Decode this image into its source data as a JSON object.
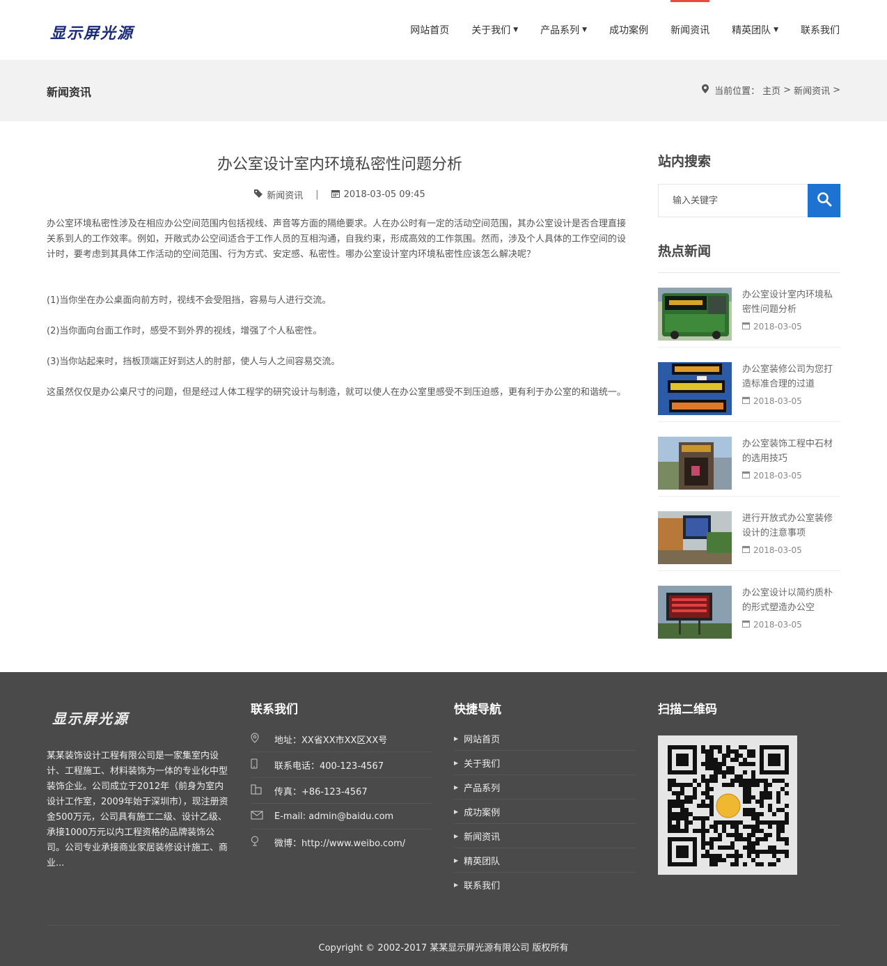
{
  "header": {
    "logo": "显示屏光源",
    "nav": [
      {
        "label": "网站首页",
        "caret": false,
        "active": false
      },
      {
        "label": "关于我们",
        "caret": true,
        "active": false
      },
      {
        "label": "产品系列",
        "caret": true,
        "active": false
      },
      {
        "label": "成功案例",
        "caret": false,
        "active": false
      },
      {
        "label": "新闻资讯",
        "caret": false,
        "active": true
      },
      {
        "label": "精英团队",
        "caret": true,
        "active": false
      },
      {
        "label": "联系我们",
        "caret": false,
        "active": false
      }
    ]
  },
  "banner": {
    "title": "新闻资讯",
    "crumb_prefix": "当前位置：",
    "crumb_home": "主页",
    "crumb_sep": ">",
    "crumb_current": "新闻资讯"
  },
  "article": {
    "title": "办公室设计室内环境私密性问题分析",
    "category": "新闻资讯",
    "divider": "|",
    "datetime": "2018-03-05 09:45",
    "paragraphs": [
      "办公室环境私密性涉及在相应办公空间范围内包括视线、声音等方面的隔绝要求。人在办公时有一定的活动空间范围，其办公室设计是否合理直接关系到人的工作效率。例如，开敞式办公空间适合于工作人员的互相沟通，自我约束，形成高效的工作氛围。然而，涉及个人具体的工作空间的设计时，要考虑到其具体工作活动的空间范围、行为方式、安定感、私密性。哪办公室设计室内环境私密性应该怎么解决呢？",
      "(1)当你坐在办公桌面向前方时，视线不会受阻挡，容易与人进行交流。",
      "(2)当你面向台面工作时，感受不到外界的视线，增强了个人私密性。",
      "(3)当你站起来时，挡板顶端正好到达人的肘部，使人与人之间容易交流。",
      "这虽然仅仅是办公桌尺寸的问题，但是经过人体工程学的研究设计与制造，就可以使人在办公室里感受不到压迫感，更有利于办公室的和谐统一。"
    ]
  },
  "sidebar": {
    "search_heading": "站内搜索",
    "search_placeholder": "输入关键字",
    "hot_heading": "热点新闻",
    "news": [
      {
        "title": "办公室设计室内环境私密性问题分析",
        "date": "2018-03-05"
      },
      {
        "title": "办公室装修公司为您打造标准合理的过道",
        "date": "2018-03-05"
      },
      {
        "title": "办公室装饰工程中石材的选用技巧",
        "date": "2018-03-05"
      },
      {
        "title": "进行开放式办公室装修设计的注意事项",
        "date": "2018-03-05"
      },
      {
        "title": "办公室设计以简约质朴的形式塑造办公空",
        "date": "2018-03-05"
      }
    ]
  },
  "footer": {
    "logo": "显示屏光源",
    "about": "某某装饰设计工程有限公司是一家集室内设计、工程施工、材料装饰为一体的专业化中型装饰企业。公司成立于2012年（前身为室内设计工作室，2009年始于深圳市），现注册资金500万元，公司具有施工二级、设计乙级、承接1000万元以内工程资格的品牌装饰公司。公司专业承接商业家居装修设计施工、商业...",
    "contact_heading": "联系我们",
    "contact": [
      {
        "icon": "location-icon",
        "text": "地址：XX省XX市XX区XX号"
      },
      {
        "icon": "phone-icon",
        "text": "联系电话：400-123-4567"
      },
      {
        "icon": "fax-icon",
        "text": "传真：+86-123-4567"
      },
      {
        "icon": "mail-icon",
        "text": "E-mail: admin@baidu.com"
      },
      {
        "icon": "weibo-icon",
        "text": "微博：http://www.weibo.com/"
      }
    ],
    "nav_heading": "快捷导航",
    "nav": [
      "网站首页",
      "关于我们",
      "产品系列",
      "成功案例",
      "新闻资讯",
      "精英团队",
      "联系我们"
    ],
    "qr_heading": "扫描二维码",
    "copyright": "Copyright © 2002-2017 某某显示屏光源有限公司 版权所有"
  },
  "colors": {
    "accent": "#1e73d2",
    "active_nav": "#e84c3d",
    "footer_bg": "#4a4a4a",
    "banner_bg": "#f2f2f2"
  }
}
